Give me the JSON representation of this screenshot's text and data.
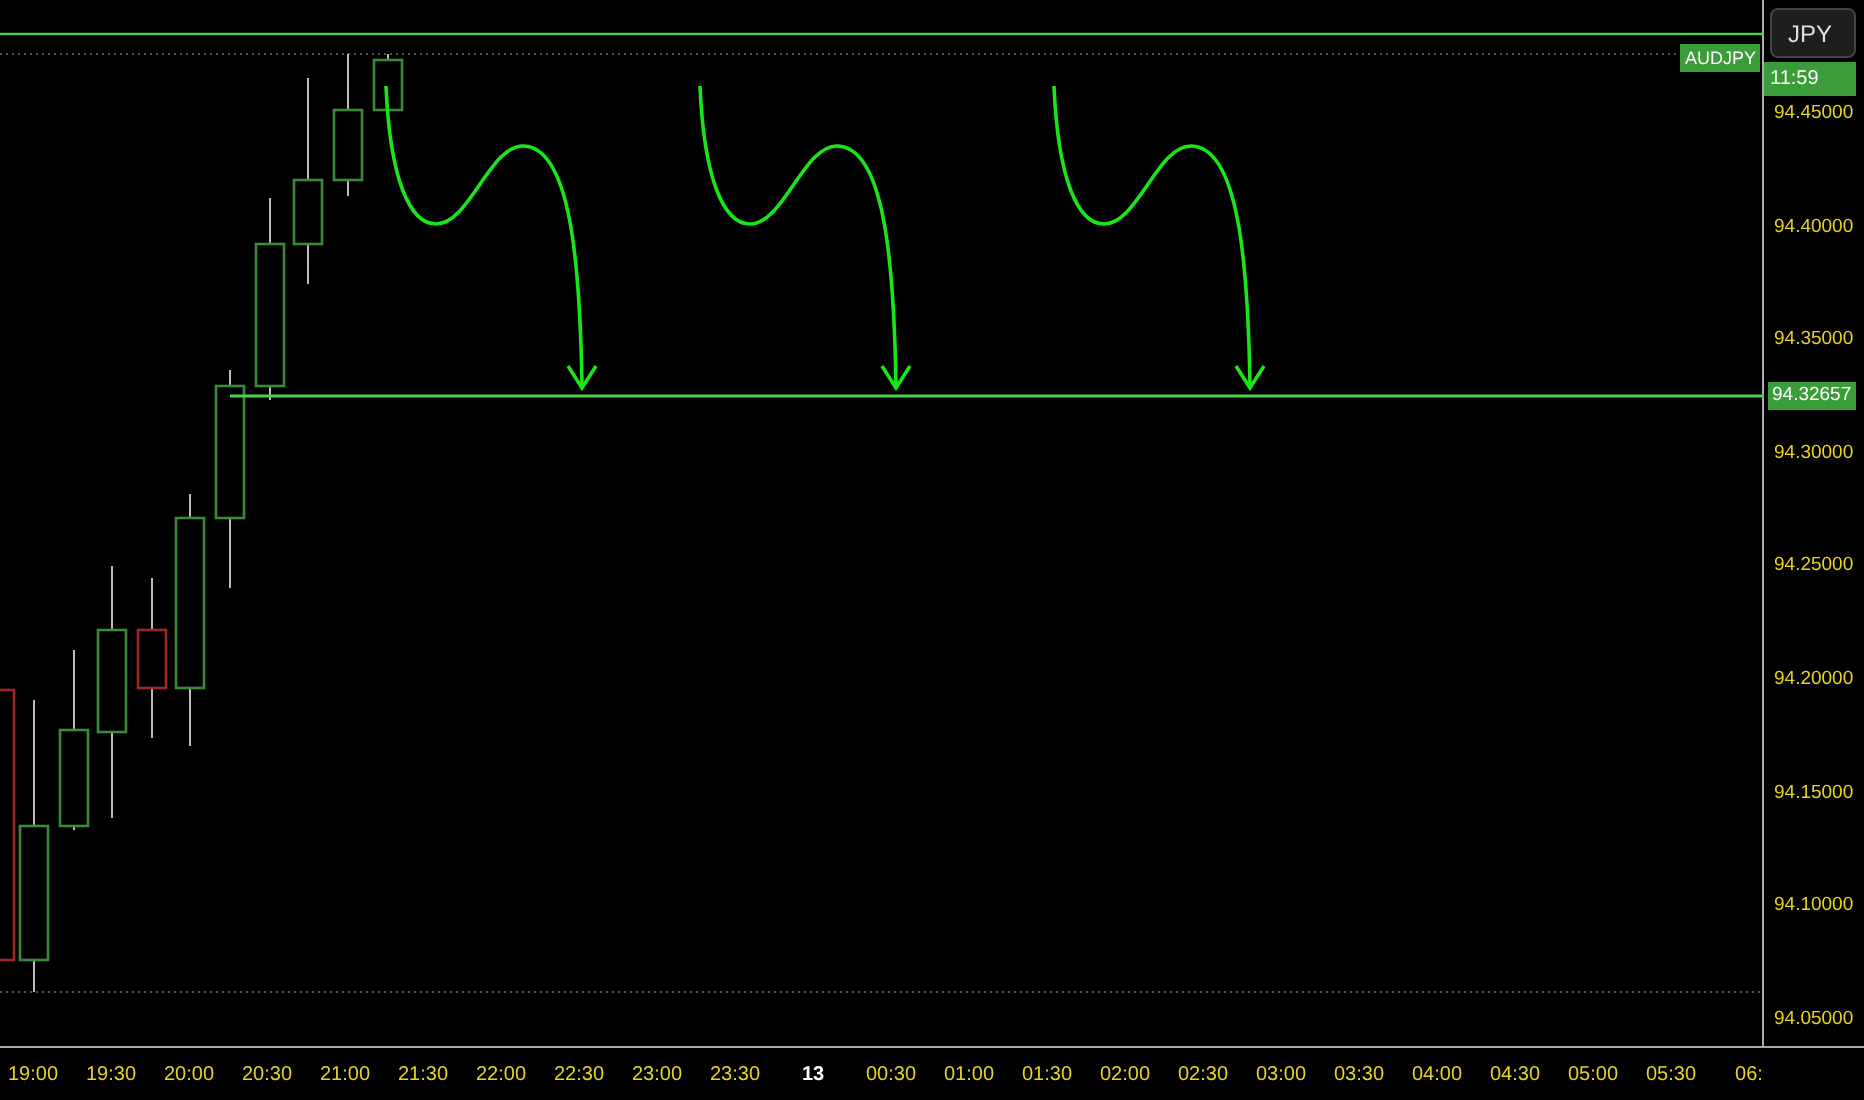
{
  "symbol_label": "AUDJPY",
  "currency_button": "JPY",
  "countdown": "11:59",
  "price_axis": {
    "labels": [
      "94.45000",
      "94.40000",
      "94.35000",
      "94.30000",
      "94.25000",
      "94.20000",
      "94.15000",
      "94.10000",
      "94.05000"
    ],
    "current_price": "94.32657"
  },
  "time_axis": {
    "labels": [
      {
        "text": "19:00",
        "kind": "time"
      },
      {
        "text": "19:30",
        "kind": "time"
      },
      {
        "text": "20:00",
        "kind": "time"
      },
      {
        "text": "20:30",
        "kind": "time"
      },
      {
        "text": "21:00",
        "kind": "time"
      },
      {
        "text": "21:30",
        "kind": "time"
      },
      {
        "text": "22:00",
        "kind": "time"
      },
      {
        "text": "22:30",
        "kind": "time"
      },
      {
        "text": "23:00",
        "kind": "time"
      },
      {
        "text": "23:30",
        "kind": "time"
      },
      {
        "text": "13",
        "kind": "date"
      },
      {
        "text": "00:30",
        "kind": "time"
      },
      {
        "text": "01:00",
        "kind": "time"
      },
      {
        "text": "01:30",
        "kind": "time"
      },
      {
        "text": "02:00",
        "kind": "time"
      },
      {
        "text": "02:30",
        "kind": "time"
      },
      {
        "text": "03:00",
        "kind": "time"
      },
      {
        "text": "03:30",
        "kind": "time"
      },
      {
        "text": "04:00",
        "kind": "time"
      },
      {
        "text": "04:30",
        "kind": "time"
      },
      {
        "text": "05:00",
        "kind": "time"
      },
      {
        "text": "05:30",
        "kind": "time"
      },
      {
        "text": "06:",
        "kind": "time"
      }
    ]
  }
}
